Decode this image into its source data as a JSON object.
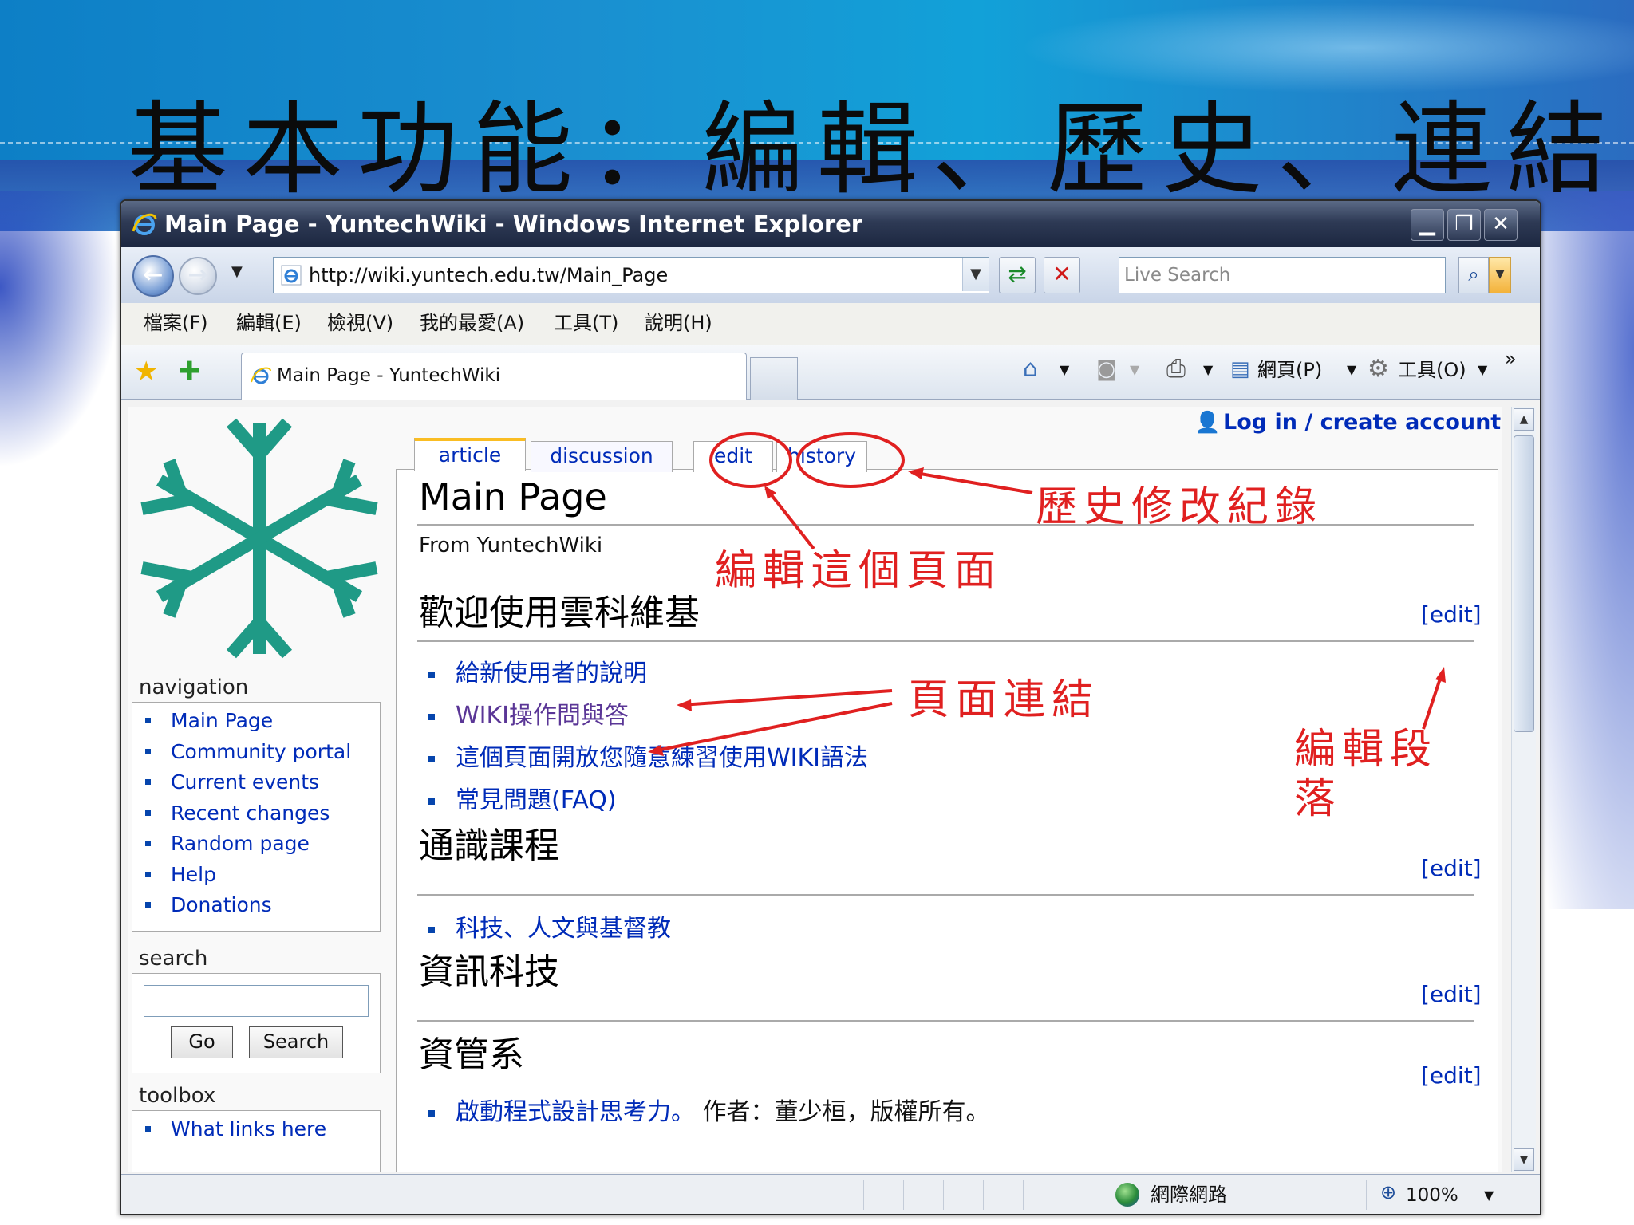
{
  "slide": {
    "title": "基本功能：編輯、歷史、連結"
  },
  "window": {
    "title": "Main Page - YuntechWiki - Windows Internet Explorer",
    "controls": {
      "minimize": "▁",
      "maximize": "❐",
      "close": "✕"
    }
  },
  "navbar": {
    "address": "http://wiki.yuntech.edu.tw/Main_Page",
    "search_placeholder": "Live Search"
  },
  "menu": {
    "items": [
      "檔案(F)",
      "編輯(E)",
      "檢視(V)",
      "我的最愛(A)",
      "工具(T)",
      "說明(H)"
    ]
  },
  "tabbar": {
    "tab_label": "Main Page - YuntechWiki",
    "page_menu": "網頁(P)",
    "tools_menu": "工具(O)",
    "overflow": "»"
  },
  "wiki": {
    "personal": {
      "login": "Log in / create account"
    },
    "tabs": {
      "article": "article",
      "discussion": "discussion",
      "edit": "edit",
      "history": "history"
    },
    "title": "Main Page",
    "site_sub": "From YuntechWiki",
    "sidebar": {
      "navigation_title": "navigation",
      "navigation": [
        "Main Page",
        "Community portal",
        "Current events",
        "Recent changes",
        "Random page",
        "Help",
        "Donations"
      ],
      "search_title": "search",
      "go_label": "Go",
      "search_label": "Search",
      "toolbox_title": "toolbox",
      "toolbox": [
        "What links here"
      ]
    },
    "sections": [
      {
        "heading": "歡迎使用雲科維基",
        "edit": "[edit]",
        "links": [
          "給新使用者的說明",
          "WIKI操作問與答",
          "這個頁面開放您隨意練習使用WIKI語法",
          "常見問題(FAQ)"
        ]
      },
      {
        "heading": "通識課程",
        "edit": "[edit]",
        "links": [
          "科技、人文與基督教"
        ]
      },
      {
        "heading": "資訊科技",
        "edit": "[edit]",
        "links": []
      },
      {
        "heading": "資管系",
        "edit": "[edit]",
        "links": [
          "啟動程式設計思考力。"
        ],
        "trailing_text": "作者：董少桓，版權所有。"
      }
    ]
  },
  "statusbar": {
    "zone": "網際網路",
    "zoom": "100%"
  },
  "annotations": {
    "history_note": "歷史修改紀錄",
    "edit_note": "編輯這個頁面",
    "links_note": "頁面連結",
    "section_edit_note_line1": "編輯段",
    "section_edit_note_line2": "落"
  },
  "colors": {
    "annotation_red": "#e02020",
    "link_blue": "#002bb8",
    "visited_purple": "#5a3696",
    "logo_teal": "#1f9a86"
  }
}
